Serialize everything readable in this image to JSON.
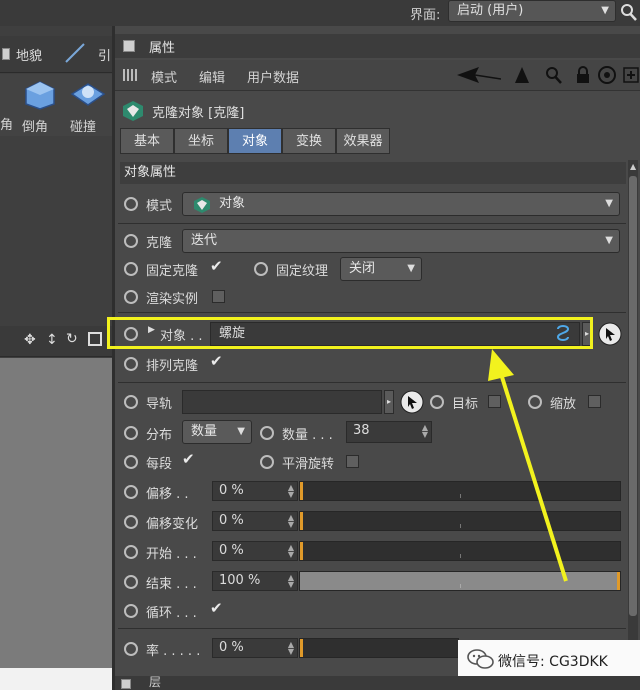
{
  "topbar": {
    "interface_label": "界面:",
    "interface_value": "启动 (用户)"
  },
  "left_panel": {
    "toolbar": {
      "item1": "地貌",
      "item2": "引"
    },
    "tools": [
      {
        "label": "倒角"
      },
      {
        "label": "碰撞"
      }
    ],
    "partial_left_label": "角"
  },
  "attributes": {
    "header_title": "属性",
    "menu": [
      "模式",
      "编辑",
      "用户数据"
    ],
    "object_title": "克隆对象 [克隆]",
    "tabs": [
      "基本",
      "坐标",
      "对象",
      "变换",
      "效果器"
    ],
    "active_tab": "对象",
    "section_title": "对象属性",
    "mode": {
      "label": "模式",
      "value": "对象"
    },
    "clone": {
      "label": "克隆",
      "value": "迭代"
    },
    "fix_clone": {
      "label": "固定克隆",
      "checked": true
    },
    "fix_texture": {
      "label": "固定纹理",
      "value": "关闭"
    },
    "render_instance": {
      "label": "渲染实例",
      "checked": false
    },
    "object": {
      "label": "对象 . .",
      "value": "螺旋"
    },
    "arrange_clones": {
      "label": "排列克隆",
      "checked": true
    },
    "rail": {
      "label": "导轨",
      "value": ""
    },
    "target": {
      "label": "目标",
      "checked": false
    },
    "scale": {
      "label": "缩放",
      "checked": false
    },
    "distribution": {
      "label": "分布",
      "value": "数量"
    },
    "count": {
      "label": "数量 . . .",
      "value": "38"
    },
    "per_segment": {
      "label": "每段",
      "checked": true
    },
    "smooth_rotation": {
      "label": "平滑旋转",
      "checked": false
    },
    "offset": {
      "label": "偏移 . .",
      "value": "0 %",
      "level": 0
    },
    "offset_variation": {
      "label": "偏移变化",
      "value": "0 %",
      "level": 0
    },
    "start": {
      "label": "开始 . . .",
      "value": "0 %",
      "level": 0
    },
    "end": {
      "label": "结束 . . .",
      "value": "100 %",
      "level": 1
    },
    "loop": {
      "label": "循环 . . .",
      "checked": true
    },
    "rate": {
      "label": "率 . . . . .",
      "value": "0 %",
      "level": 0
    },
    "bottom_partial": "层"
  },
  "watermark": {
    "text": "微信号: CG3DKK"
  },
  "colors": {
    "accent": "#5d7fb0",
    "highlight": "#f2f21e",
    "slider_marker": "#e09a2a"
  }
}
